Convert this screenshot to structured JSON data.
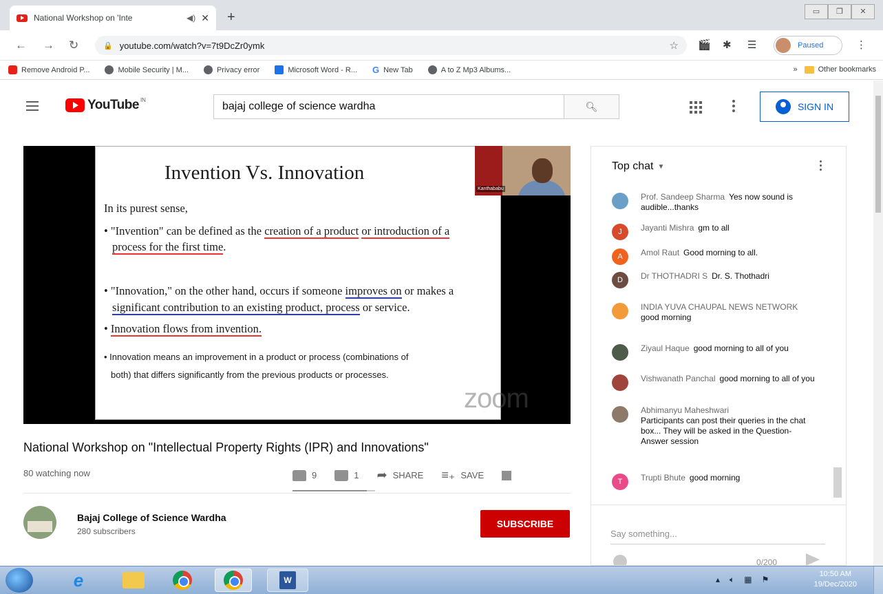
{
  "browser": {
    "tab_title": "National Workshop on 'Inte",
    "url": "youtube.com/watch?v=7t9DcZr0ymk",
    "profile_status": "Paused",
    "bookmarks": [
      {
        "label": "Remove Android P...",
        "icon": "youtube-favicon"
      },
      {
        "label": "Mobile Security | M...",
        "icon": "globe-icon"
      },
      {
        "label": "Privacy error",
        "icon": "globe-icon"
      },
      {
        "label": "Microsoft Word - R...",
        "icon": "word-favicon"
      },
      {
        "label": "New Tab",
        "icon": "google-icon"
      },
      {
        "label": "A to Z Mp3 Albums...",
        "icon": "globe-icon"
      }
    ],
    "more_bookmarks": "»",
    "other_bookmarks": "Other bookmarks"
  },
  "youtube": {
    "logo_text": "YouTube",
    "region": "IN",
    "search_value": "bajaj college of science wardha",
    "sign_in": "SIGN IN"
  },
  "slide": {
    "title": "Invention Vs. Innovation",
    "line1": "In its purest sense,",
    "b1_pre": "• \"Invention\" can be defined as the ",
    "b1_u1": "creation of a product",
    "b1_mid": " ",
    "b1_u2": "or introduction of a",
    "b1_u3": "process for the first time",
    "b1_end": ".",
    "b2_pre": "• \"Innovation,\" on the other hand, occurs if someone ",
    "b2_u1": "improves on",
    "b2_post": " or makes a",
    "b2_u2": "significant contribution to an existing product, process",
    "b2_end": " or service.",
    "b3_pre": "• ",
    "b3_u": "Innovation flows from invention.",
    "b4_l1": "• Innovation means an improvement in a product or process (combinations of",
    "b4_l2": "both) that differs significantly from the previous products or processes.",
    "camera_name": "Kanthababu",
    "watermark": "zoom"
  },
  "video": {
    "title": "National Workshop on \"Intellectual Property Rights (IPR) and Innovations\"",
    "watching": "80 watching now",
    "likes": "9",
    "dislikes": "1",
    "share": "SHARE",
    "save": "SAVE",
    "like_ratio": 0.9
  },
  "channel": {
    "name": "Bajaj College of Science Wardha",
    "subscribers": "280 subscribers",
    "subscribe": "SUBSCRIBE"
  },
  "chat": {
    "header": "Top chat",
    "messages": [
      {
        "author": "Prof. Sandeep Sharma",
        "text": "Yes now sound is audible...thanks",
        "avatar_color": "#6aa0c8",
        "initial": ""
      },
      {
        "author": "Jayanti Mishra",
        "text": "gm to all",
        "avatar_color": "#d84a2c",
        "initial": "J"
      },
      {
        "author": "Amol Raut",
        "text": "Good morning to all.",
        "avatar_color": "#f2621f",
        "initial": "A"
      },
      {
        "author": "Dr THOTHADRI S",
        "text": "Dr. S. Thothadri",
        "avatar_color": "#6d4c41",
        "initial": "D"
      },
      {
        "author": "INDIA YUVA CHAUPAL NEWS NETWORK",
        "text": "good morning",
        "avatar_color": "#f29b38",
        "initial": ""
      },
      {
        "author": "Ziyaul Haque",
        "text": "good morning to all of you",
        "avatar_color": "#4e5b4a",
        "initial": ""
      },
      {
        "author": "Vishwanath Panchal",
        "text": "good morning to all of you",
        "avatar_color": "#a0453c",
        "initial": ""
      },
      {
        "author": "Abhimanyu Maheshwari",
        "text": "Participants can post their queries in the chat box... They will be asked in the Question-Answer session",
        "avatar_color": "#8d7a6a",
        "initial": ""
      },
      {
        "author": "Trupti Bhute",
        "text": "good morning",
        "avatar_color": "#e84a8a",
        "initial": "T"
      }
    ],
    "input_placeholder": "Say something...",
    "char_count": "0/200"
  },
  "taskbar": {
    "time": "10:50 AM",
    "date": "19/Dec/2020"
  }
}
